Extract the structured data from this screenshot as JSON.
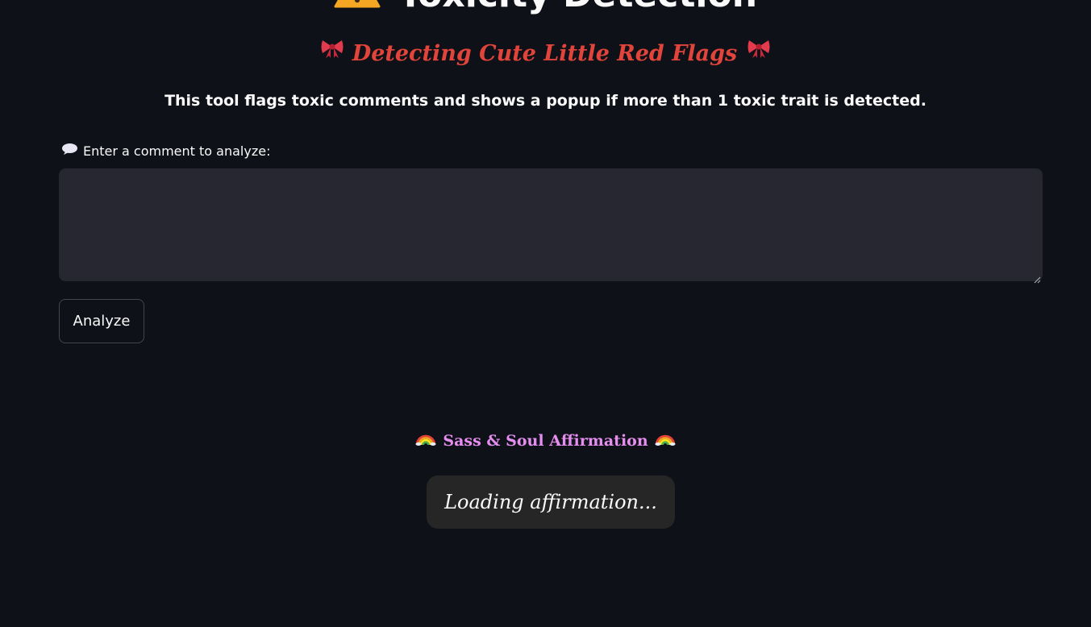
{
  "header": {
    "title": "Toxicity Detection",
    "title_icon": "warning-icon",
    "subtitle": "Detecting Cute Little Red Flags",
    "subtitle_icon": "ribbon-icon",
    "subtitle_color": "#e0443a",
    "description": "This tool flags toxic comments and shows a popup if more than 1 toxic trait is detected."
  },
  "comment_form": {
    "label": "Enter a comment to analyze:",
    "label_icon": "speech-balloon-icon",
    "value": "",
    "placeholder": "",
    "analyze_label": "Analyze"
  },
  "affirmation": {
    "heading": "Sass & Soul Affirmation",
    "heading_icon": "rainbow-icon",
    "heading_color": "#e58ef0",
    "text": "Loading affirmation..."
  },
  "theme": {
    "background": "#0e1117",
    "input_background": "#262730",
    "text": "#fafafa"
  }
}
